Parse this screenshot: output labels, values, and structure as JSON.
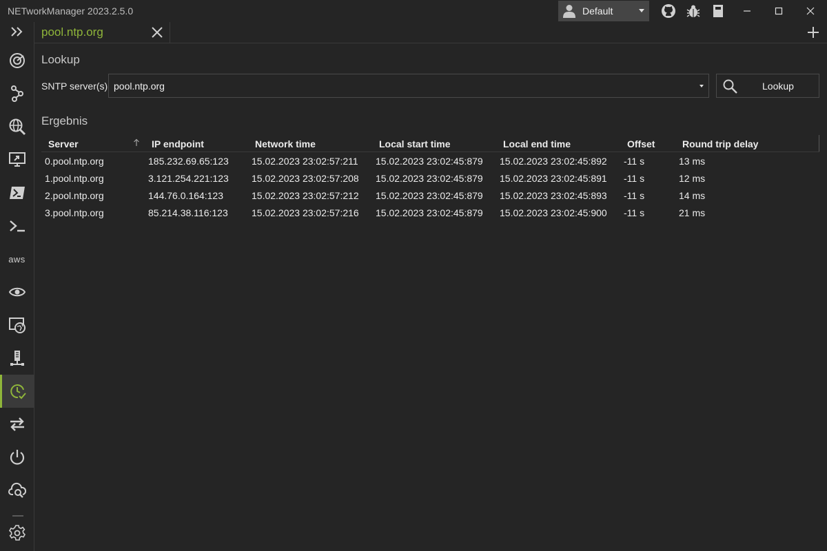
{
  "app": {
    "title": "NETworkManager 2023.2.5.0"
  },
  "profile": {
    "selected": "Default"
  },
  "tab": {
    "label": "pool.ntp.org"
  },
  "lookup": {
    "section_title": "Lookup",
    "server_label": "SNTP server(s)",
    "server_value": "pool.ntp.org",
    "button_label": "Lookup"
  },
  "result": {
    "section_title": "Ergebnis",
    "columns": [
      "Server",
      "IP endpoint",
      "Network time",
      "Local start time",
      "Local end time",
      "Offset",
      "Round trip delay"
    ],
    "rows": [
      [
        "0.pool.ntp.org",
        "185.232.69.65:123",
        "15.02.2023 23:02:57:211",
        "15.02.2023 23:02:45:879",
        "15.02.2023 23:02:45:892",
        "-11 s",
        "13 ms"
      ],
      [
        "1.pool.ntp.org",
        "3.121.254.221:123",
        "15.02.2023 23:02:57:208",
        "15.02.2023 23:02:45:879",
        "15.02.2023 23:02:45:891",
        "-11 s",
        "12 ms"
      ],
      [
        "2.pool.ntp.org",
        "144.76.0.164:123",
        "15.02.2023 23:02:57:212",
        "15.02.2023 23:02:45:879",
        "15.02.2023 23:02:45:893",
        "-11 s",
        "14 ms"
      ],
      [
        "3.pool.ntp.org",
        "85.214.38.116:123",
        "15.02.2023 23:02:57:216",
        "15.02.2023 23:02:45:879",
        "15.02.2023 23:02:45:900",
        "-11 s",
        "21 ms"
      ]
    ]
  },
  "sidebar": {
    "aws_label": "aws",
    "items": [
      "expand-icon",
      "dashboard-icon",
      "network-connections-icon",
      "web-console-icon",
      "remote-desktop-icon",
      "powershell-icon",
      "putty-icon",
      "aws-session-manager-icon",
      "tightvnc-icon",
      "web-browser-icon",
      "snmp-icon",
      "sntp-lookup-icon",
      "connections-icon",
      "wake-on-lan-icon",
      "whois-icon",
      "settings-icon"
    ],
    "active": "sntp-lookup-icon"
  },
  "colors": {
    "accent": "#8fb53a",
    "background": "#252525",
    "border": "#3a3a3a"
  }
}
